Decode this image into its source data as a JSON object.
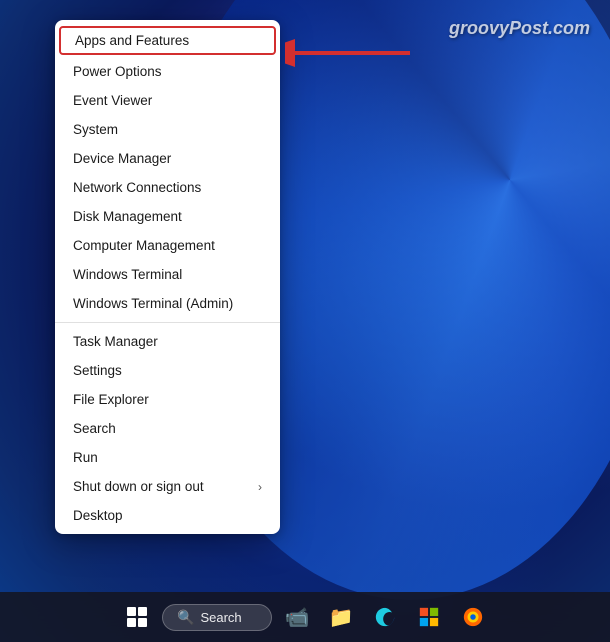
{
  "watermark": {
    "text": "groovyPost.com"
  },
  "contextMenu": {
    "items": [
      {
        "id": "apps-features",
        "label": "Apps and Features",
        "highlighted": true
      },
      {
        "id": "power-options",
        "label": "Power Options",
        "highlighted": false
      },
      {
        "id": "event-viewer",
        "label": "Event Viewer",
        "highlighted": false
      },
      {
        "id": "system",
        "label": "System",
        "highlighted": false
      },
      {
        "id": "device-manager",
        "label": "Device Manager",
        "highlighted": false
      },
      {
        "id": "network-connections",
        "label": "Network Connections",
        "highlighted": false
      },
      {
        "id": "disk-management",
        "label": "Disk Management",
        "highlighted": false
      },
      {
        "id": "computer-management",
        "label": "Computer Management",
        "highlighted": false
      },
      {
        "id": "windows-terminal",
        "label": "Windows Terminal",
        "highlighted": false
      },
      {
        "id": "windows-terminal-admin",
        "label": "Windows Terminal (Admin)",
        "highlighted": false
      }
    ],
    "divider1": true,
    "items2": [
      {
        "id": "task-manager",
        "label": "Task Manager",
        "highlighted": false
      },
      {
        "id": "settings",
        "label": "Settings",
        "highlighted": false
      },
      {
        "id": "file-explorer",
        "label": "File Explorer",
        "highlighted": false
      },
      {
        "id": "search",
        "label": "Search",
        "highlighted": false
      },
      {
        "id": "run",
        "label": "Run",
        "highlighted": false
      },
      {
        "id": "shut-down",
        "label": "Shut down or sign out",
        "hasSubmenu": true,
        "highlighted": false
      },
      {
        "id": "desktop",
        "label": "Desktop",
        "highlighted": false
      }
    ]
  },
  "taskbar": {
    "searchLabel": "Search",
    "icons": [
      {
        "id": "windows",
        "symbol": "⊞",
        "label": "Start"
      },
      {
        "id": "zoom",
        "symbol": "📹",
        "label": "Zoom"
      },
      {
        "id": "files",
        "symbol": "📁",
        "label": "File Explorer"
      },
      {
        "id": "edge",
        "symbol": "🌐",
        "label": "Microsoft Edge"
      },
      {
        "id": "store",
        "symbol": "🪟",
        "label": "Microsoft Store"
      },
      {
        "id": "firefox",
        "symbol": "🦊",
        "label": "Firefox"
      }
    ]
  }
}
